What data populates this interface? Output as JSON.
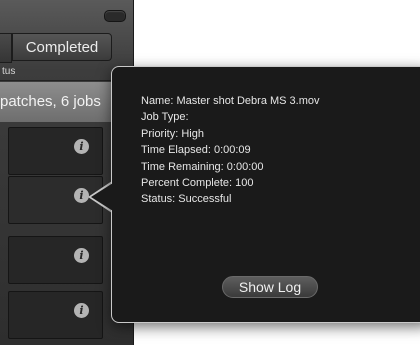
{
  "window": {
    "tabs": {
      "completed_label": "Completed"
    },
    "status_column_header": "tus",
    "summary_text": "patches, 6 jobs",
    "rows": [
      {
        "info_icon": "info-icon"
      },
      {
        "info_icon": "info-icon"
      },
      {
        "info_icon": "info-icon"
      },
      {
        "info_icon": "info-icon"
      }
    ]
  },
  "popover": {
    "name": "Name: Master shot Debra MS 3.mov",
    "job_type": "Job Type:",
    "priority": "Priority: High",
    "time_elapsed": "Time Elapsed: 0:00:09",
    "time_remaining": "Time Remaining: 0:00:00",
    "percent_complete": "Percent Complete: 100",
    "status": "Status: Successful",
    "show_log_label": "Show Log"
  },
  "icons": {
    "info_glyph": "i"
  },
  "colors": {
    "popover_bg": "#1a1a1a",
    "popover_border": "#c9c9c9",
    "window_bg": "#2e2e2e"
  }
}
